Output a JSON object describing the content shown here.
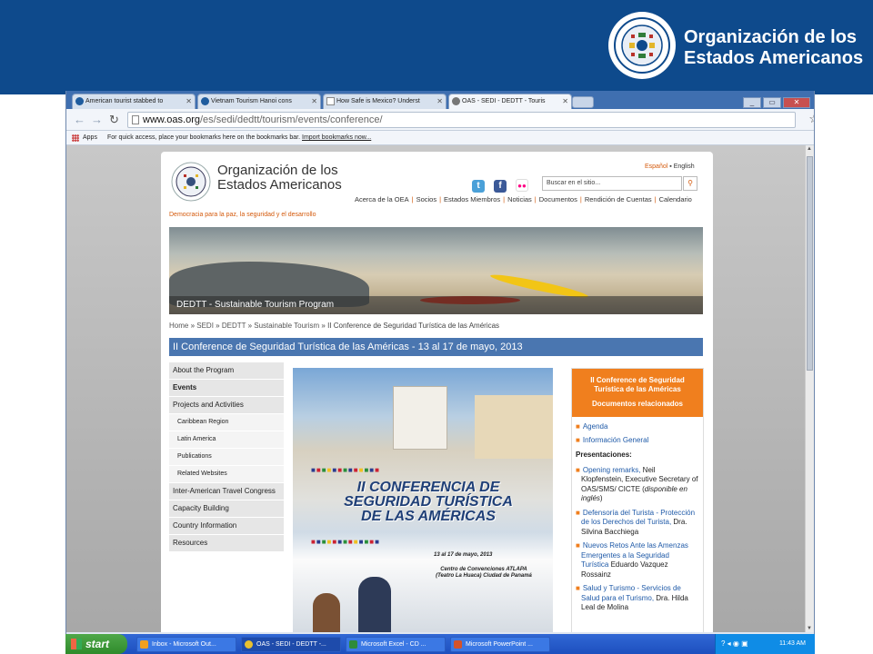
{
  "banner": {
    "title_line1": "Organización de los",
    "title_line2": "Estados Americanos",
    "logo_icon": "oas-seal-icon",
    "background": "#0e4a8c"
  },
  "browser": {
    "tabs": [
      {
        "label": "American tourist stabbed to"
      },
      {
        "label": "Vietnam Tourism Hanoi cons"
      },
      {
        "label": "How Safe is Mexico? Underst"
      },
      {
        "label": "OAS - SEDI - DEDTT - Touris",
        "active": true
      }
    ],
    "address_host": "www.oas.org",
    "address_path": "/es/sedi/dedtt/tourism/events/conference/",
    "bookmarks": {
      "apps_label": "Apps",
      "prompt": "For quick access, place your bookmarks here on the bookmarks bar.",
      "import_link": "Import bookmarks now..."
    }
  },
  "site": {
    "name_line1": "Organización de los",
    "name_line2": "Estados Americanos",
    "tagline": "Democracia para la paz, la seguridad y el desarrollo",
    "lang_es": "Español",
    "lang_en": "English",
    "search_placeholder": "Buscar en el sitio...",
    "nav": [
      "Acerca de la OEA",
      "Socios",
      "Estados Miembros",
      "Noticias",
      "Documentos",
      "Rendición de Cuentas",
      "Calendario"
    ],
    "hero_caption": "DEDTT - Sustainable Tourism Program",
    "breadcrumb": [
      "Home",
      "SEDI",
      "DEDTT",
      "Sustainable Tourism",
      "II Conference de Seguridad Turística de las Américas"
    ],
    "page_title": "II Conference de Seguridad Turística de las Américas - 13 al 17 de mayo, 2013",
    "sidenav": [
      {
        "label": "About the Program",
        "type": "top"
      },
      {
        "label": "Events",
        "type": "top",
        "bold": true
      },
      {
        "label": "Projects and Activities",
        "type": "top"
      },
      {
        "label": "Caribbean Region",
        "type": "sub"
      },
      {
        "label": "Latin America",
        "type": "sub"
      },
      {
        "label": "Publications",
        "type": "sub"
      },
      {
        "label": "Related Websites",
        "type": "sub"
      },
      {
        "label": "Inter-American Travel Congress",
        "type": "top"
      },
      {
        "label": "Capacity Building",
        "type": "top"
      },
      {
        "label": "Country Information",
        "type": "top"
      },
      {
        "label": "Resources",
        "type": "top"
      }
    ],
    "poster": {
      "title_line1": "II CONFERENCIA DE",
      "title_line2": "SEGURIDAD TURÍSTICA",
      "title_line3": "DE LAS AMÉRICAS",
      "date": "13 al 17 de mayo, 2013",
      "venue": "Centro de Convenciones ATLAPA (Teatro La Huaca) Ciudad de Panamá"
    },
    "rbox": {
      "head_line1": "II Conference de Seguridad",
      "head_line2": "Turística de las Américas",
      "head_sub": "Documentos relacionados",
      "links": [
        "Agenda",
        "Información General"
      ],
      "pres_heading": "Presentaciones:",
      "presentations": [
        {
          "link": "Opening remarks,",
          "text": " Neil Klopfenstein, Executive Secretary of OAS/SMS/ CICTE (",
          "italic": "disponible en inglés",
          "end": ")"
        },
        {
          "link": "Defensoría del Turista - Protección de los Derechos del Turista,",
          "text": " Dra. Silvina Bacchiega"
        },
        {
          "link": "Nuevos Retos Ante las Amenzas Emergentes a la Seguridad Turística",
          "text": " Eduardo Vazquez Rossainz"
        },
        {
          "link": "Salud y Turismo - Servicios de Salud para el Turismo,",
          "text": " Dra. Hilda Leal de Molina"
        }
      ]
    }
  },
  "taskbar": {
    "start_label": "start",
    "items": [
      {
        "label": "Inbox - Microsoft Out...",
        "color": "#f0a020"
      },
      {
        "label": "OAS - SEDI - DEDTT -...",
        "color": "#e8c030",
        "active": true
      },
      {
        "label": "Microsoft Excel - CD ...",
        "color": "#2e8b3a"
      },
      {
        "label": "Microsoft PowerPoint ...",
        "color": "#d5532a"
      }
    ],
    "clock": "11:43 AM"
  }
}
